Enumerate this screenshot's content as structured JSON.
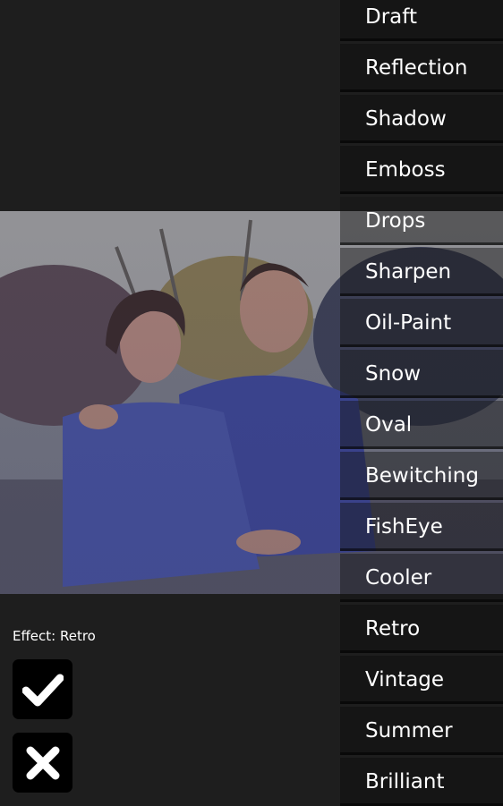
{
  "status": {
    "text": "Effect: Retro"
  },
  "effects": [
    "Draft",
    "Reflection",
    "Shadow",
    "Emboss",
    "Drops",
    "Sharpen",
    "Oil-Paint",
    "Snow",
    "Oval",
    "Bewitching",
    "FishEye",
    "Cooler",
    "Retro",
    "Vintage",
    "Summer",
    "Brilliant"
  ],
  "buttons": {
    "apply_icon": "check-icon",
    "cancel_icon": "close-icon"
  },
  "colors": {
    "background": "#1e1e1e",
    "list_bg": "#141414",
    "button_bg": "#000000",
    "text": "#ffffff"
  }
}
